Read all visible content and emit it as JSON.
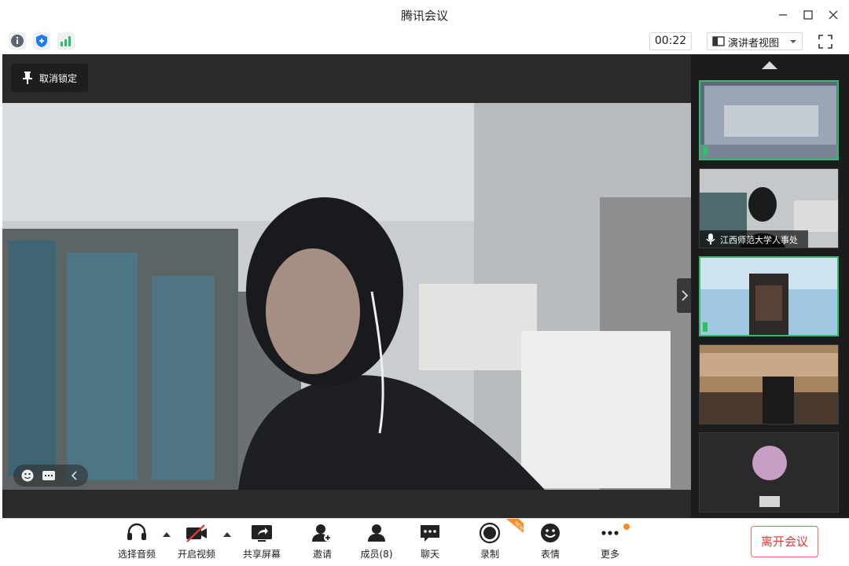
{
  "window": {
    "title": "腾讯会议"
  },
  "toolbar": {
    "info_icon": "info-icon",
    "security_icon": "shield-icon",
    "signal_icon": "signal-bars-icon",
    "timer": "00:22",
    "layout_label": "演讲者视图",
    "fullscreen_icon": "fullscreen-icon"
  },
  "stage": {
    "unpin_label": "取消锁定"
  },
  "participants": [
    {
      "name": "",
      "speaking": false,
      "active": true
    },
    {
      "name": "江西师范大学人事处",
      "speaking": true,
      "active": false
    },
    {
      "name": "",
      "speaking": false,
      "active": true
    },
    {
      "name": "",
      "speaking": false,
      "active": false
    },
    {
      "name": "",
      "speaking": false,
      "active": false
    }
  ],
  "controls": {
    "audio": "选择音频",
    "video": "开启视频",
    "share": "共享屏幕",
    "invite": "邀请",
    "members": "成员(8)",
    "chat": "聊天",
    "record": "录制",
    "reactions": "表情",
    "more": "更多",
    "leave": "离开会议",
    "new_badge": "NEW"
  },
  "colors": {
    "accent_green": "#2dbf6a",
    "leave_red": "#e53935",
    "badge_orange": "#ff8a1f"
  }
}
